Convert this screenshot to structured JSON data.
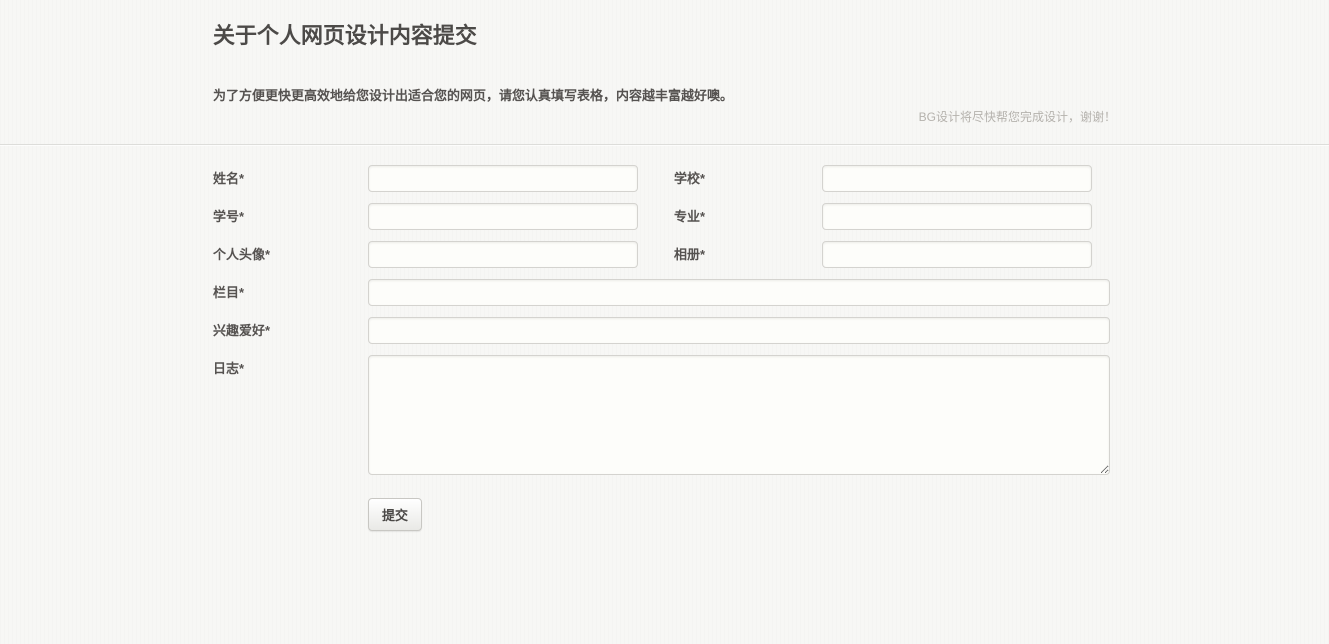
{
  "header": {
    "title": "关于个人网页设计内容提交",
    "subtitle": "为了方便更快更高效地给您设计出适合您的网页，请您认真填写表格，内容越丰富越好噢。",
    "note": "BG设计将尽快帮您完成设计，谢谢！"
  },
  "form": {
    "fields": [
      {
        "label": "姓名*",
        "value": ""
      },
      {
        "label": "学校*",
        "value": ""
      },
      {
        "label": "学号*",
        "value": ""
      },
      {
        "label": "专业*",
        "value": ""
      },
      {
        "label": "个人头像*",
        "value": ""
      },
      {
        "label": "相册*",
        "value": ""
      },
      {
        "label": "栏目*",
        "value": ""
      },
      {
        "label": "兴趣爱好*",
        "value": ""
      },
      {
        "label": "日志*",
        "value": ""
      }
    ],
    "submit_label": "提交"
  },
  "colors": {
    "page_background": "#f7f7f5",
    "divider": "#ddddda",
    "label_text": "#555250",
    "note_text": "#b5b2ad",
    "input_background": "#fdfdfa",
    "input_border": "#d4d3cf"
  }
}
